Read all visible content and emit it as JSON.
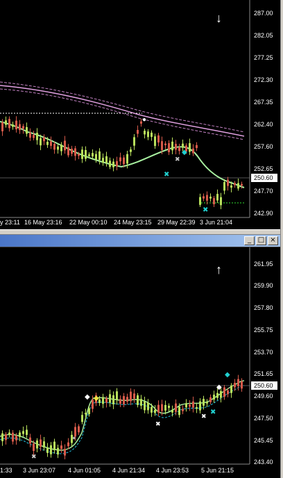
{
  "top_chart": {
    "direction_icon": "arrow-down-icon",
    "price_labels": [
      "287.00",
      "282.05",
      "277.25",
      "272.30",
      "267.35",
      "262.40",
      "257.60",
      "252.65",
      "247.70",
      "242.90"
    ],
    "current_price": "250.60",
    "time_labels": [
      "y 23:11",
      "16 May 23:16",
      "22 May 00:10",
      "24 May 23:15",
      "29 May 22:39",
      "3 Jun 21:04"
    ]
  },
  "bottom_chart": {
    "direction_icon": "arrow-up-icon",
    "window_buttons": [
      "_",
      "□",
      "×"
    ],
    "price_labels": [
      "261.95",
      "259.90",
      "257.80",
      "255.75",
      "253.70",
      "251.65",
      "249.60",
      "247.50",
      "245.45",
      "243.40"
    ],
    "current_price": "250.60",
    "time_labels": [
      "1:33",
      "3 Jun 23:07",
      "4 Jun 01:05",
      "4 Jun 21:34",
      "4 Jun 23:53",
      "5 Jun 21:15"
    ]
  },
  "colors": {
    "bull_candle": "#b8e05c",
    "bear_candle": "#d65a4a",
    "ma_green": "#a8f0a0",
    "ma_pink": "#e0a0e0",
    "cyan_marker": "#20d0d0"
  }
}
